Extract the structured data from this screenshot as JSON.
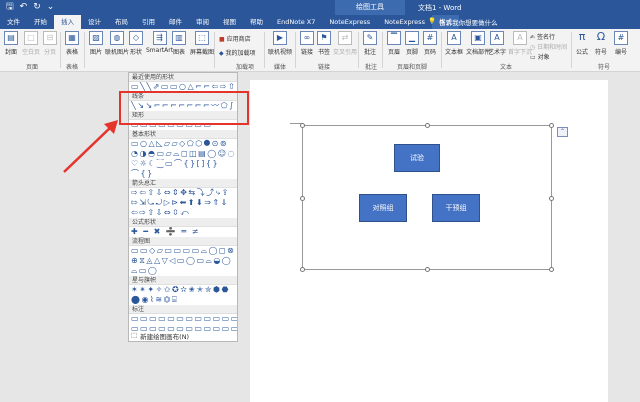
{
  "titlebar": {
    "icons": [
      "save-icon",
      "undo-icon",
      "redo-icon",
      "customize-qat-icon"
    ],
    "glyphs": {
      "save": "🖫",
      "undo": "↶",
      "redo": "↻",
      "more": "⌄"
    },
    "context_title": "绘图工具",
    "doc_title": "文档1 - Word"
  },
  "tabs": [
    "文件",
    "开始",
    "插入",
    "设计",
    "布局",
    "引用",
    "邮件",
    "审阅",
    "视图",
    "帮助",
    "EndNote X7",
    "NoteExpress",
    "NoteExpress",
    "格式"
  ],
  "active_tab": "插入",
  "tell_me": {
    "icon": "lightbulb-icon",
    "glyph": "💡",
    "text": "告诉我你想要做什么"
  },
  "ribbon": {
    "buttons": {
      "cover": "封面",
      "blank": "空白页",
      "pagebreak": "分页",
      "table": "表格",
      "picture": "图片",
      "online_pictures": "联机图片",
      "shapes": "形状",
      "smartart": "SmartArt",
      "chart": "图表",
      "screenshot": "屏幕截图",
      "store": "应用商店",
      "my_addins": "我的加载项",
      "online_video": "联机视频",
      "link": "链接",
      "bookmark": "书签",
      "crossref": "交叉引用",
      "comment": "批注",
      "header": "页眉",
      "footer": "页脚",
      "page_number": "页码",
      "textbox": "文本框",
      "doc_parts": "文档部件",
      "wordart": "艺术字",
      "dropcap": "首字下沉",
      "signature": "签名行",
      "datetime": "日期和时间",
      "object": "对象",
      "equation": "公式",
      "symbol": "符号",
      "number": "编号"
    },
    "groups": {
      "pages": "页面",
      "tables": "表格",
      "addins": "加载项",
      "media": "媒体",
      "links": "链接",
      "comments": "批注",
      "header_footer": "页眉和页脚",
      "text": "文本",
      "symbols": "符号"
    }
  },
  "shapes_panel": {
    "categories": {
      "recent": "最近使用的形状",
      "lines": "线条",
      "rectangles": "矩形",
      "basic": "基本形状",
      "arrows": "箭头总汇",
      "equation": "公式形状",
      "flowchart": "流程图",
      "stars": "星与旗帜",
      "callouts": "标注"
    },
    "rows": {
      "recent": "▭╲╲⇗▭▭○△⌐⌐⇦⇨⇧⇩",
      "lines": "╲↘↘⌐⌐⌐⌐⌐⌐⌐〰⬠∫",
      "rectangles": "▭▭▭▭▭▭▭▭▭",
      "basic1": "▭○△◺▱▱◇⬠⬡⯃⊙⊚",
      "basic2": "◔◑◓▭▱⌓◻◫▤◯☺◌",
      "basic3": "♡☼☾⁐▭⌒{}[]{}",
      "basic4": "⌒{}",
      "arrows1": "⇨⇦⇧⇩⇔⇕✥⇆⤵⤴⤷⇪",
      "arrows2": "⇰⇲⤿⤾▷⊳⬅⬆⬇⇒⇑⇓",
      "arrows3": "⇦⇨⇧⇩⇔⇳⤺",
      "equation": "✚ ━ ✖ ➗ ═ ≠",
      "flow1": "▭▭◇▱▭▭▭▭⌓◯◻⊗",
      "flow2": "⊕⧖◬△▽◁▭◯▭⌓◒◯",
      "flow3": "⌓▭◯",
      "stars1": "✶✴✦✧✩✪✫✬✭✮⬢⬣",
      "stars2": "⬤◉⌇≋⏣⌸",
      "callouts1": "▭▭▭▭▭▭▭▭▭▭▭▭",
      "callouts2": "▭▭▭▭▭▭▭▭▭▭▭▭"
    },
    "new_canvas": "新建绘图画布(N)",
    "new_canvas_glyph": "⬚"
  },
  "canvas_boxes": {
    "top": "试验",
    "left": "对照组",
    "right": "干预组"
  },
  "layout_options_glyph": "⌃",
  "colors": {
    "word_blue": "#2b579a",
    "highlight_red": "#e5342b",
    "box_fill": "#4472c4"
  }
}
